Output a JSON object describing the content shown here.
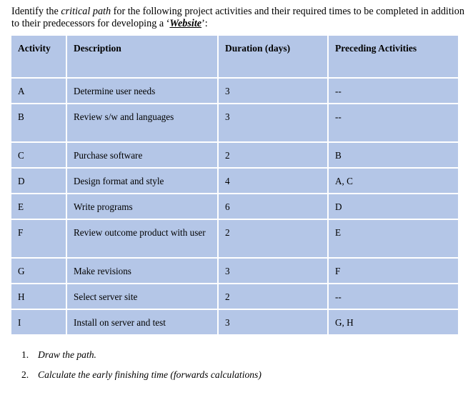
{
  "intro": {
    "part1": "Identify the ",
    "emphasis": "critical path",
    "part2": " for the following project activities and their required times to be completed in addition to their predecessors for developing a ",
    "open_quote": "‘",
    "keyword": "Website",
    "close_quote": "’:"
  },
  "table": {
    "colors": {
      "cell_background": "#b4c6e7",
      "grid_lines": "#ffffff"
    },
    "headers": {
      "activity": "Activity",
      "description": "Description",
      "duration": "Duration (days)",
      "preceding": "Preceding Activities"
    },
    "rows": [
      {
        "activity": "A",
        "description": "Determine user needs",
        "duration": "3",
        "preceding": "--"
      },
      {
        "activity": "B",
        "description": "Review s/w and languages",
        "duration": "3",
        "preceding": "--"
      },
      {
        "activity": "C",
        "description": "Purchase software",
        "duration": "2",
        "preceding": "B"
      },
      {
        "activity": "D",
        "description": "Design format and style",
        "duration": "4",
        "preceding": "A, C"
      },
      {
        "activity": "E",
        "description": "Write programs",
        "duration": "6",
        "preceding": "D"
      },
      {
        "activity": "F",
        "description": "Review outcome product with user",
        "duration": "2",
        "preceding": "E"
      },
      {
        "activity": "G",
        "description": "Make revisions",
        "duration": "3",
        "preceding": "F"
      },
      {
        "activity": "H",
        "description": "Select server site",
        "duration": "2",
        "preceding": "--"
      },
      {
        "activity": "I",
        "description": "Install on server and test",
        "duration": "3",
        "preceding": "G, H"
      }
    ]
  },
  "questions": [
    {
      "number": "1.",
      "text": "Draw the path."
    },
    {
      "number": "2.",
      "text": "Calculate the early finishing time (forwards calculations)"
    }
  ]
}
